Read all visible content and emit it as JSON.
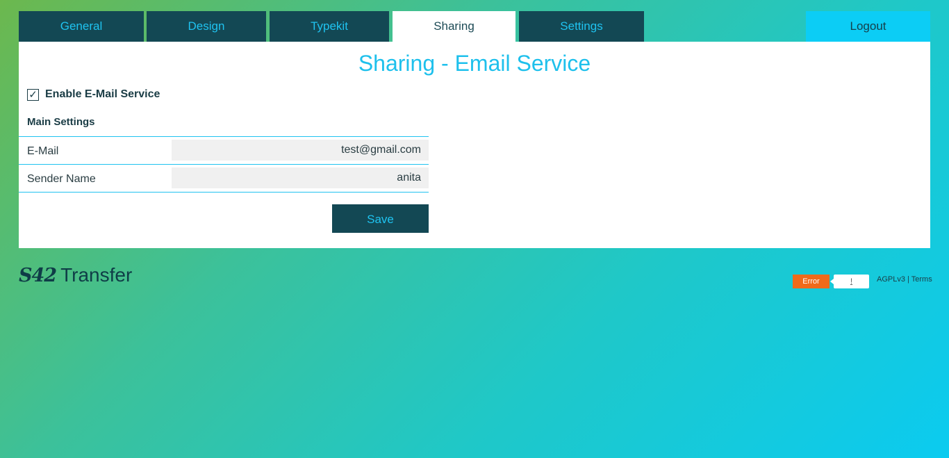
{
  "nav": {
    "tabs": [
      {
        "label": "General"
      },
      {
        "label": "Design"
      },
      {
        "label": "Typekit"
      },
      {
        "label": "Sharing"
      },
      {
        "label": "Settings"
      }
    ],
    "logout_label": "Logout",
    "active_tab": "Sharing"
  },
  "main": {
    "title": "Sharing - Email Service",
    "enable": {
      "checked": true,
      "check_glyph": "✓",
      "label": "Enable E-Mail Service"
    },
    "section_title": "Main Settings",
    "fields": [
      {
        "label": "E-Mail",
        "value": "test@gmail.com"
      },
      {
        "label": "Sender Name",
        "value": "anita"
      }
    ],
    "save_label": "Save"
  },
  "footer": {
    "brand_logo": "S42",
    "brand_name": "Transfer",
    "error_label": "Error",
    "error_detail": "!",
    "license": "AGPLv3",
    "separator": "|",
    "terms": "Terms"
  },
  "colors": {
    "accent": "#1fc3f0",
    "dark": "#134854",
    "error": "#f06a1a"
  }
}
